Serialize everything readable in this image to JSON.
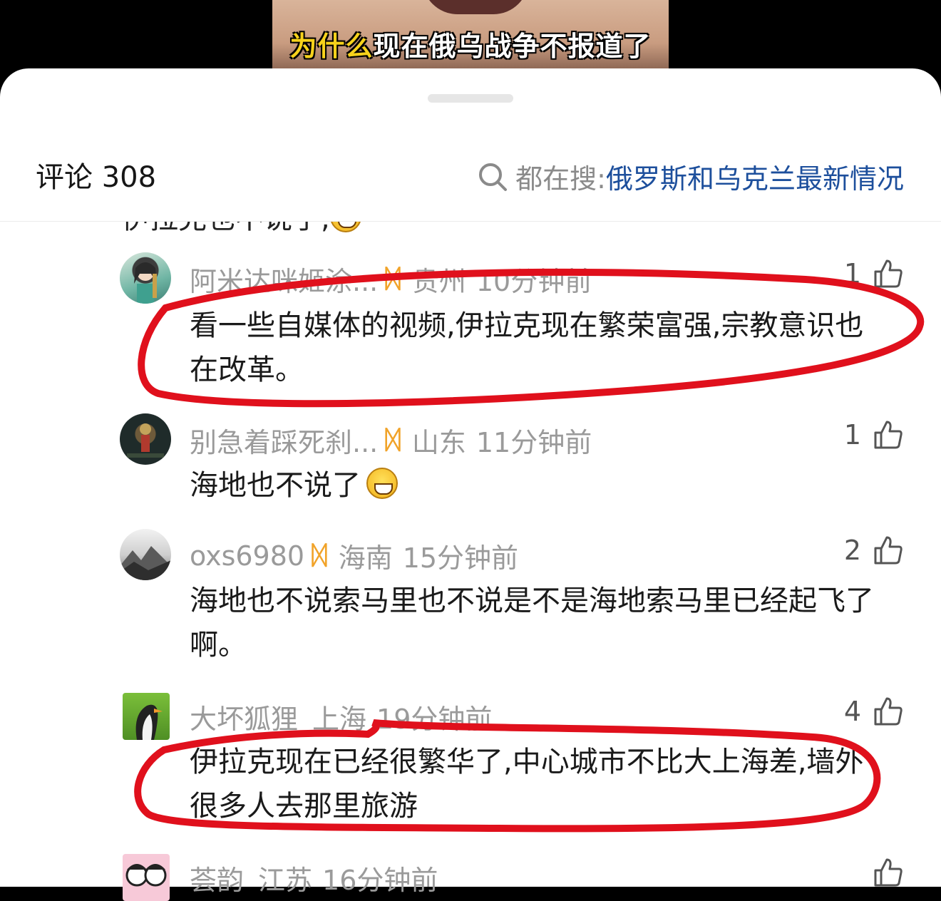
{
  "video": {
    "caption_highlight": "为什么",
    "caption_rest": "现在俄乌战争不报道了"
  },
  "header": {
    "comment_count": "评论 308",
    "search_label": "都在搜:",
    "search_query": "俄罗斯和乌克兰最新情况"
  },
  "partial_text": "伊拉克也不说了,",
  "badge_glyph": "ᛞ",
  "comments": [
    {
      "username": "阿米达咪姬涂...",
      "region": "贵州",
      "time": "10分钟前",
      "likes": "1",
      "text": "看一些自媒体的视频,伊拉克现在繁荣富强,宗教意识也在改革。"
    },
    {
      "username": "别急着踩死刹...",
      "region": "山东",
      "time": "11分钟前",
      "likes": "1",
      "text": "海地也不说了"
    },
    {
      "username": "oxs6980",
      "region": "海南",
      "time": "15分钟前",
      "likes": "2",
      "text": "海地也不说索马里也不说是不是海地索马里已经起飞了啊。"
    },
    {
      "username": "大坏狐狸",
      "region": "上海",
      "time": "19分钟前",
      "likes": "4",
      "text": "伊拉克现在已经很繁华了,中心城市不比大上海差,墙外很多人去那里旅游"
    },
    {
      "username": "荟韵",
      "region": "江苏",
      "time": "16分钟前",
      "likes": "",
      "text": ""
    }
  ],
  "colors": {
    "accent_link": "#1d4f9c",
    "badge": "#f1a329",
    "annotation": "#e0101c"
  }
}
